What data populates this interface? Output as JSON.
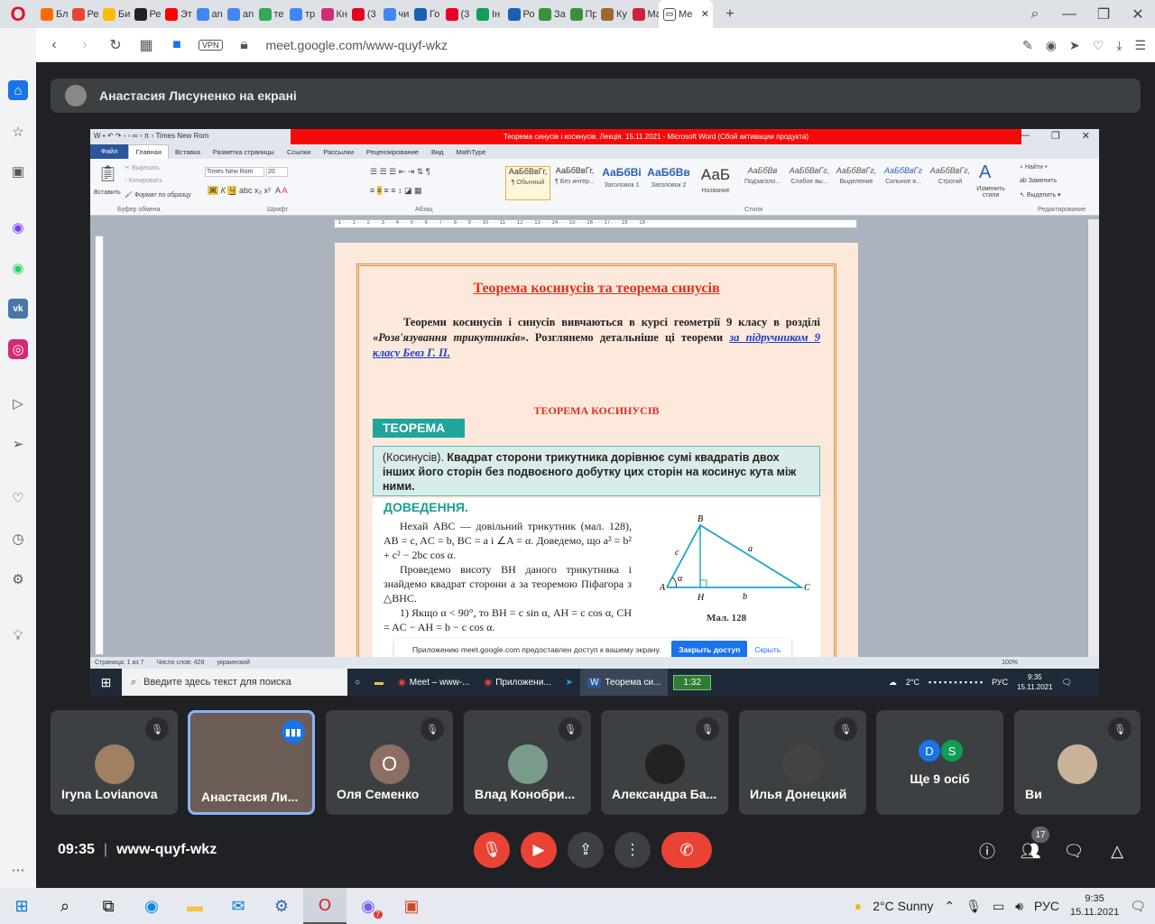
{
  "browser": {
    "tabs": [
      "Бл",
      "Ре",
      "Би",
      "Ре",
      "Эт",
      "an",
      "an",
      "те",
      "тр",
      "Кн",
      "(3",
      "чи",
      "Го",
      "(3",
      "Ін",
      "Ро",
      "За",
      "Пр",
      "Ку",
      "Ма"
    ],
    "tab_favicon_colors": [
      "#ff6a00",
      "#ea4335",
      "#fbbc05",
      "#222222",
      "#ff0000",
      "#4285f4",
      "#4285f4",
      "#34a853",
      "#4285f4",
      "#d12c79",
      "#e60023",
      "#4285f4",
      "#1a5fb4",
      "#e60023",
      "#0f9d58",
      "#1a5fb4",
      "#3d8f3d",
      "#3d8f3d",
      "#9a6a2f",
      "#d1213b"
    ],
    "active_tab": "Ме",
    "url": "meet.google.com/www-quyf-wkz",
    "vpn_label": "VPN"
  },
  "meet": {
    "presenter_banner": "Анастасия Лисуненко на екрані",
    "meeting_time": "09:35",
    "meeting_code": "www-quyf-wkz",
    "participant_count": "17",
    "participants": [
      {
        "name": "Iryna Lovianova",
        "initial": ""
      },
      {
        "name": "Анастасия Ли...",
        "initial": ""
      },
      {
        "name": "Оля Семенко",
        "initial": "О"
      },
      {
        "name": "Влад Конобри...",
        "initial": ""
      },
      {
        "name": "Александра Ба...",
        "initial": ""
      },
      {
        "name": "Илья Донецкий",
        "initial": ""
      },
      {
        "name": "Ще 9 осіб",
        "initial": ""
      },
      {
        "name": "Ви",
        "initial": ""
      }
    ],
    "more_initials": [
      "D",
      "S"
    ]
  },
  "word": {
    "title": "Теорема синусів і косинусів. Лекція.  15.11.2021 - Microsoft Word (Сбой активации продукта)",
    "font_name": "Times New Rom",
    "font_size": "20",
    "ribbon_tabs": [
      "Файл",
      "Главная",
      "Вставка",
      "Разметка страницы",
      "Ссылки",
      "Рассылки",
      "Рецензирование",
      "Вид",
      "MathType"
    ],
    "clipboard": {
      "paste": "Вставить",
      "cut": "Вырезать",
      "copy": "Копировать",
      "format": "Формат по образцу",
      "group": "Буфер обмена"
    },
    "groups": {
      "font": "Шрифт",
      "para": "Абзац",
      "styles": "Стили",
      "edit": "Редактирование"
    },
    "styles": [
      {
        "preview": "АаБбВвГг,",
        "name": "¶ Обычный"
      },
      {
        "preview": "АаБбВвГг,",
        "name": "¶ Без интер..."
      },
      {
        "preview": "АаБбВі",
        "name": "Заголовок 1"
      },
      {
        "preview": "АаБбВв",
        "name": "Заголовок 2"
      },
      {
        "preview": "АаБ",
        "name": "Название"
      },
      {
        "preview": "АаБбВв",
        "name": "Подзаголо..."
      },
      {
        "preview": "АаБбВвГг,",
        "name": "Слабое вы..."
      },
      {
        "preview": "АаБбВвГг,",
        "name": "Выделение"
      },
      {
        "preview": "АаБбВвГг",
        "name": "Сильное в..."
      },
      {
        "preview": "АаБбВвГг,",
        "name": "Строгий"
      }
    ],
    "change_styles": "Изменить стили",
    "edit": {
      "find": "Найти",
      "replace": "Заменить",
      "select": "Выделить"
    },
    "status": {
      "page": "Страница: 1 из 7",
      "words": "Число слов: 428",
      "lang": "украинский",
      "zoom": "100%"
    }
  },
  "document": {
    "title": "Теорема косинусів та теорема синусів",
    "intro_plain": "Теореми косинусів і синусів вивчаються в курсі геометрії 9 класу в розділі «",
    "intro_italic": "Розв'язування трикутників",
    "intro_rest": "». Розглянемо детальніше ці теореми ",
    "intro_link": "за підручником 9 класу Бевз Г. П.",
    "cos_heading": "ТЕОРЕМА КОСИНУСІВ",
    "theorem_tag": "ТЕОРЕМА",
    "theorem_prefix": "(Косинусів). ",
    "theorem_text": "Квадрат сторони трикутника дорівнює сумі квадратів двох інших його сторін без подвоєного добутку цих сторін на косинус кута між ними.",
    "proof_heading": "ДОВЕДЕННЯ.",
    "proof_lines": [
      "Нехай ABC — довільний трикутник (мал. 128), AB = c, AC = b, BC = a і ∠A = α. Доведемо, що a² = b² + c² − 2bc cos α.",
      "Проведемо висоту BH даного трикутника і знайдемо квадрат сторони a за теоремою Піфагора з △BHC.",
      "1) Якщо α < 90°, то BH = c sin α, AH = c cos α, CH = AC − AH = b − c cos α."
    ],
    "figure_labels": {
      "A": "A",
      "B": "B",
      "C": "C",
      "H": "H",
      "a": "a",
      "b": "b",
      "c": "c",
      "alpha": "α"
    },
    "figure_caption": "Мал. 128"
  },
  "notice": {
    "text": "Приложению meet.google.com предоставлен доступ к вашему экрану.",
    "share": "Закрыть доступ",
    "hide": "Скрыть"
  },
  "remote_taskbar": {
    "search": "Введите здесь текст для поиска",
    "apps": [
      "Meet – www-...",
      "Приложени...",
      "Теорема си..."
    ],
    "timer": "1:32",
    "weather": "2°C",
    "lang": "РУС",
    "time": "9:35",
    "date": "15.11.2021"
  },
  "windows": {
    "weather": "2°C  Sunny",
    "lang": "РУС",
    "time": "9:35",
    "date": "15.11.2021",
    "notif_badge": "7"
  }
}
